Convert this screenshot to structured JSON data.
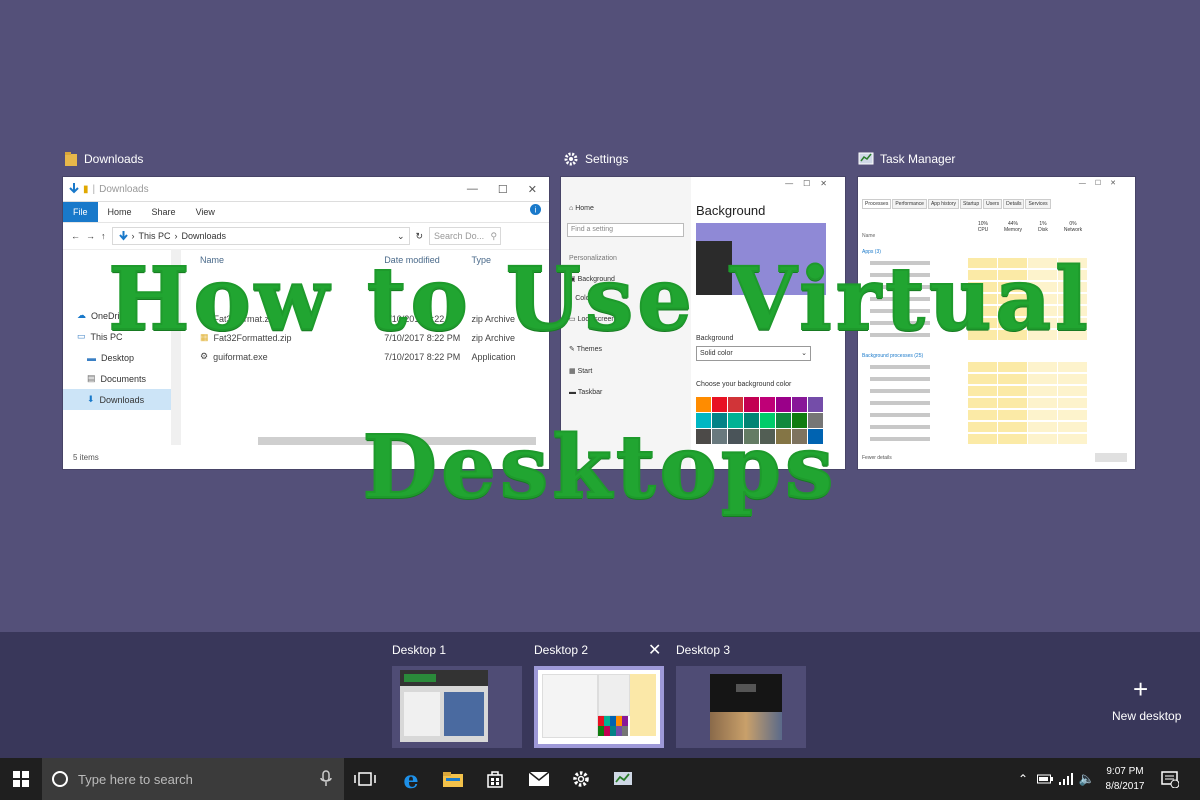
{
  "overlay": {
    "line1": "How to Use Virtual",
    "line2": "Desktops"
  },
  "windows": {
    "explorer": {
      "caption": "Downloads",
      "title": "Downloads",
      "ribbon": [
        "File",
        "Home",
        "Share",
        "View"
      ],
      "path": [
        "This PC",
        "Downloads"
      ],
      "search_placeholder": "Search Do...",
      "nav": [
        "OneDrive",
        "This PC",
        "Desktop",
        "Documents",
        "Downloads"
      ],
      "columns": [
        "Name",
        "Date modified",
        "Type"
      ],
      "files": [
        {
          "name": "Fat32format.zip",
          "date": "7/10/2017 8:22 PM",
          "type": "zip Archive"
        },
        {
          "name": "Fat32Formatted.zip",
          "date": "7/10/2017 8:22 PM",
          "type": "zip Archive"
        },
        {
          "name": "guiformat.exe",
          "date": "7/10/2017 8:22 PM",
          "type": "Application"
        }
      ],
      "status": "5 items"
    },
    "settings": {
      "caption": "Settings",
      "side_items": [
        "Home",
        "Find a setting",
        "Personalization",
        "Background",
        "Colors",
        "Lock screen",
        "Themes",
        "Start",
        "Taskbar"
      ],
      "heading": "Background",
      "background_label": "Background",
      "background_value": "Solid color",
      "colors_label": "Choose your background color",
      "swatches": [
        "#ff8c00",
        "#e81123",
        "#d13438",
        "#c30052",
        "#bf0077",
        "#9a0089",
        "#881798",
        "#744da9",
        "#00b7c3",
        "#038387",
        "#00b294",
        "#018574",
        "#00cc6a",
        "#10893e",
        "#107c10",
        "#767676",
        "#4c4a48",
        "#69797e",
        "#4a5459",
        "#647c64",
        "#525e54",
        "#847545",
        "#7e735f",
        "#0063b1"
      ]
    },
    "taskmgr": {
      "caption": "Task Manager",
      "tabs": [
        "Processes",
        "Performance",
        "App history",
        "Startup",
        "Users",
        "Details",
        "Services"
      ],
      "columns": [
        "Name",
        "CPU",
        "Memory",
        "Disk",
        "Network"
      ],
      "column_pcts": [
        "10%",
        "44%",
        "1%",
        "0%"
      ],
      "section_apps": "Apps (3)",
      "section_bg": "Background processes (25)",
      "footer": "Fewer details"
    }
  },
  "desktops": [
    {
      "label": "Desktop 1",
      "active": false
    },
    {
      "label": "Desktop 2",
      "active": true
    },
    {
      "label": "Desktop 3",
      "active": false
    }
  ],
  "new_desktop": {
    "label": "New desktop"
  },
  "taskbar": {
    "search_placeholder": "Type here to search",
    "time": "9:07 PM",
    "date": "8/8/2017"
  },
  "colors": {
    "desktop_bg": "#545079",
    "headline": "#21a531",
    "accent": "#1979ca"
  }
}
